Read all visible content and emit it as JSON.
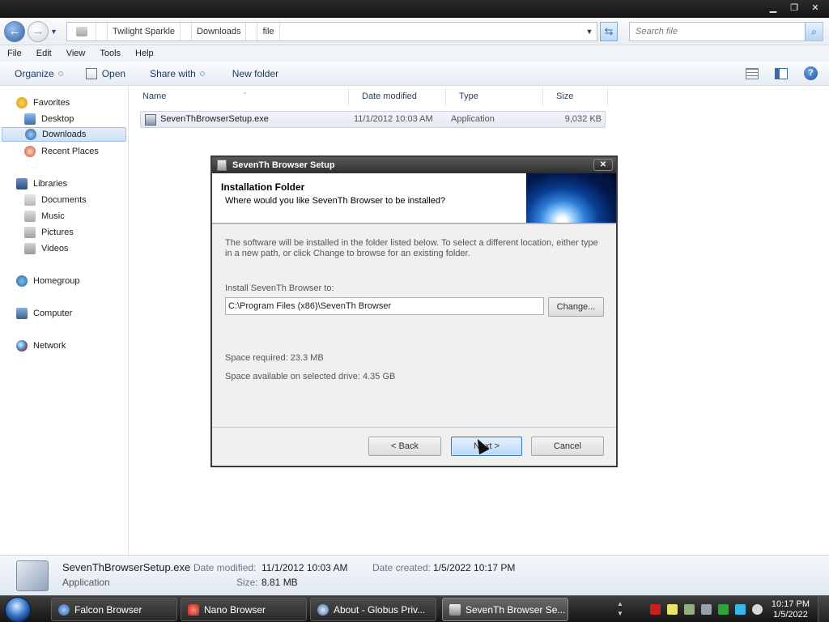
{
  "window": {
    "controls": {
      "minimize": "▁",
      "maximize": "❐",
      "close": "✕"
    }
  },
  "address": {
    "crumbs": [
      "Twilight Sparkle",
      "Downloads",
      "file"
    ],
    "search_placeholder": "Search file"
  },
  "menu": [
    "File",
    "Edit",
    "View",
    "Tools",
    "Help"
  ],
  "commands": {
    "organize": "Organize",
    "open": "Open",
    "share": "Share with",
    "new_folder": "New folder"
  },
  "nav": {
    "favorites": "Favorites",
    "desktop": "Desktop",
    "downloads": "Downloads",
    "recent": "Recent Places",
    "libraries": "Libraries",
    "documents": "Documents",
    "music": "Music",
    "pictures": "Pictures",
    "videos": "Videos",
    "homegroup": "Homegroup",
    "computer": "Computer",
    "network": "Network"
  },
  "columns": [
    "Name",
    "Date modified",
    "Type",
    "Size"
  ],
  "files": [
    {
      "name": "SevenThBrowserSetup.exe",
      "date": "11/1/2012 10:03 AM",
      "type": "Application",
      "size": "9,032 KB"
    }
  ],
  "dialog": {
    "title": "SevenTh Browser Setup",
    "heading": "Installation Folder",
    "subheading": "Where would you like SevenTh Browser to be installed?",
    "description": "The software will be installed in the folder listed below. To select a different location, either type in a new path, or click Change to browse for an existing folder.",
    "install_label": "Install SevenTh Browser to:",
    "install_path": "C:\\Program Files (x86)\\SevenTh Browser",
    "change_button": "Change...",
    "space_required": "Space required: 23.3 MB",
    "space_available": "Space available on selected drive: 4.35 GB",
    "back_button": "< Back",
    "next_button": "Next >",
    "cancel_button": "Cancel"
  },
  "details": {
    "name": "SevenThBrowserSetup.exe",
    "type": "Application",
    "date_modified_label": "Date modified:",
    "date_modified": "11/1/2012 10:03 AM",
    "date_created_label": "Date created:",
    "date_created": "1/5/2022 10:17 PM",
    "size_label": "Size:",
    "size": "8.81 MB"
  },
  "taskbar": {
    "items": [
      "Falcon Browser",
      "Nano Browser",
      "About - Globus Priv...",
      "SevenTh Browser Se..."
    ],
    "time": "10:17 PM",
    "date": "1/5/2022"
  },
  "colors": {
    "accent": "#3b7ac6",
    "selection": "#cfe1f7",
    "titlebar": "#1b1b1b"
  }
}
